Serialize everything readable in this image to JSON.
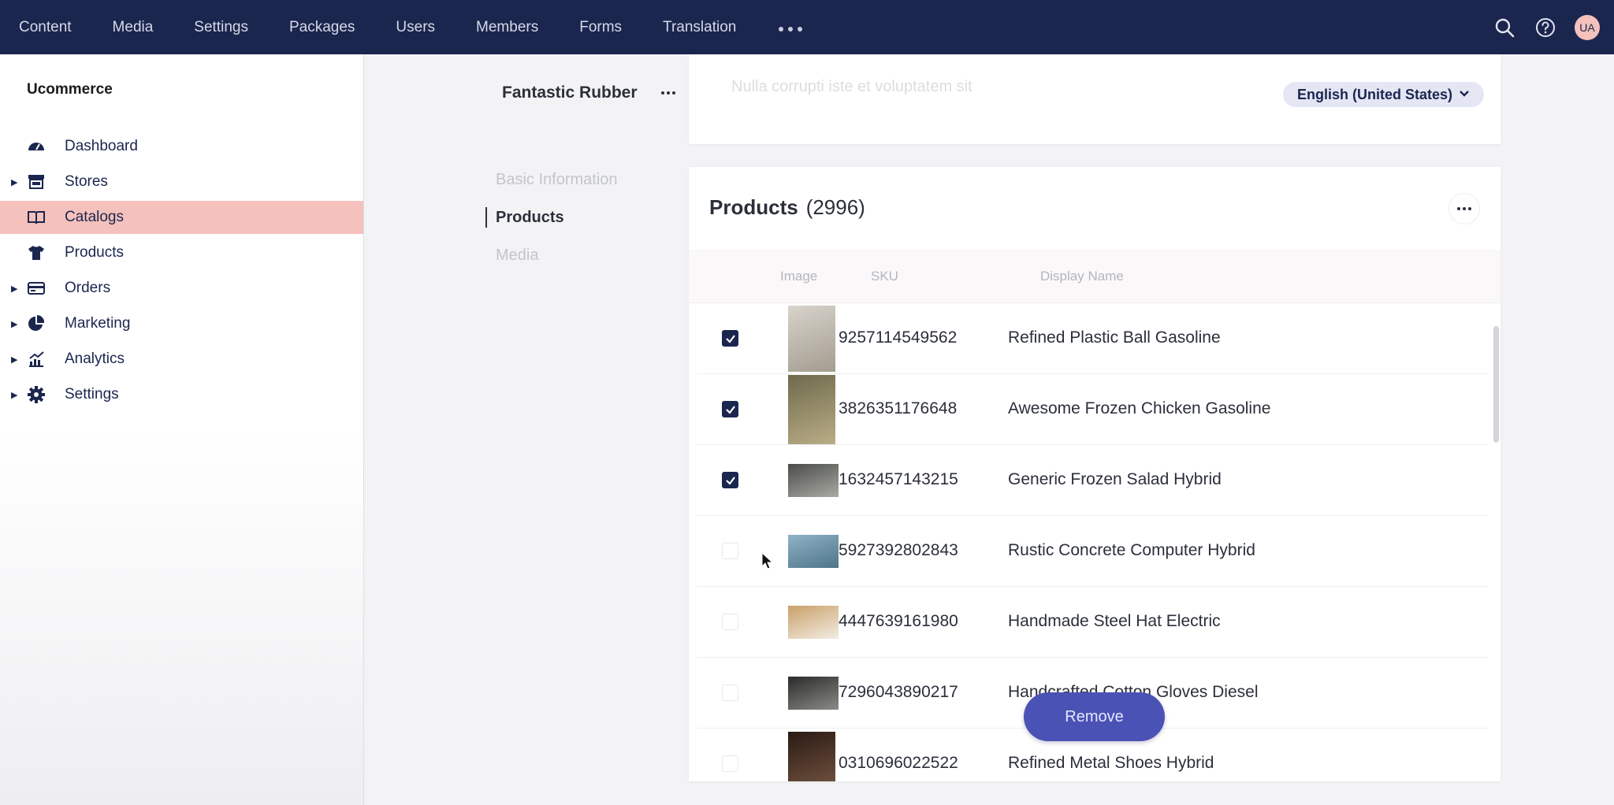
{
  "topnav": {
    "items": [
      "Content",
      "Media",
      "Settings",
      "Packages",
      "Users",
      "Members",
      "Forms",
      "Translation"
    ],
    "more_icon": "ellipsis-icon",
    "search_icon": "search-icon",
    "help_icon": "help-icon",
    "avatar_initials": "UA"
  },
  "sidebar": {
    "brand": "Ucommerce",
    "items": [
      {
        "label": "Dashboard",
        "icon": "dashboard-icon",
        "expandable": false,
        "active": false
      },
      {
        "label": "Stores",
        "icon": "store-icon",
        "expandable": true,
        "active": false
      },
      {
        "label": "Catalogs",
        "icon": "catalog-icon",
        "expandable": false,
        "active": true
      },
      {
        "label": "Products",
        "icon": "shirt-icon",
        "expandable": false,
        "active": false
      },
      {
        "label": "Orders",
        "icon": "credit-card-icon",
        "expandable": true,
        "active": false
      },
      {
        "label": "Marketing",
        "icon": "pie-chart-icon",
        "expandable": true,
        "active": false
      },
      {
        "label": "Analytics",
        "icon": "analytics-icon",
        "expandable": true,
        "active": false
      },
      {
        "label": "Settings",
        "icon": "gear-icon",
        "expandable": true,
        "active": false
      }
    ]
  },
  "node": {
    "title": "Fantastic Rubber",
    "tabs": [
      "Basic Information",
      "Products",
      "Media"
    ],
    "active_tab": "Products"
  },
  "info_card": {
    "faded_text": "Nulla corrupti iste et voluptatem sit",
    "language": "English (United States)"
  },
  "products": {
    "title": "Products",
    "count": "(2996)",
    "columns": {
      "image": "Image",
      "sku": "SKU",
      "display_name": "Display Name"
    },
    "rows": [
      {
        "checked": true,
        "sku": "9257114549562",
        "name": "Refined Plastic Ball Gasoline",
        "thumb_colors": [
          "#d8d4cc",
          "#a39c90"
        ]
      },
      {
        "checked": true,
        "sku": "3826351176648",
        "name": "Awesome Frozen Chicken Gasoline",
        "thumb_colors": [
          "#6f6a4c",
          "#b9ad86"
        ]
      },
      {
        "checked": true,
        "sku": "1632457143215",
        "name": "Generic Frozen Salad Hybrid",
        "thumb_colors": [
          "#4b4d4a",
          "#a9aaa3"
        ]
      },
      {
        "checked": false,
        "sku": "5927392802843",
        "name": "Rustic Concrete Computer Hybrid",
        "thumb_colors": [
          "#8fb3c7",
          "#4e7488"
        ]
      },
      {
        "checked": false,
        "sku": "4447639161980",
        "name": "Handmade Steel Hat Electric",
        "thumb_colors": [
          "#c9a06a",
          "#f3ece2"
        ]
      },
      {
        "checked": false,
        "sku": "7296043890217",
        "name": "Handcrafted Cotton Gloves Diesel",
        "thumb_colors": [
          "#2b2b2b",
          "#8a8a86"
        ]
      },
      {
        "checked": false,
        "sku": "0310696022522",
        "name": "Refined Metal Shoes Hybrid",
        "thumb_colors": [
          "#2a1a14",
          "#7a5a45"
        ]
      }
    ],
    "remove_label": "Remove"
  },
  "colors": {
    "topbar": "#1b264f",
    "active_item": "#f5c1bc",
    "primary_button": "#4b52b5",
    "checkbox_checked": "#1b264f"
  }
}
